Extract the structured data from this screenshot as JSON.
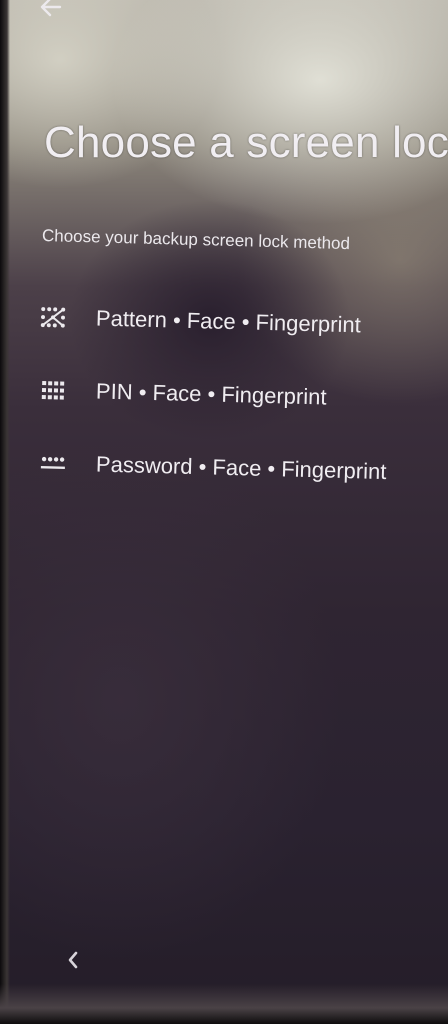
{
  "header": {
    "back_icon": "arrow-left-icon"
  },
  "page": {
    "title": "Choose a screen loc",
    "subtitle": "Choose your backup screen lock method"
  },
  "options": [
    {
      "icon": "pattern-icon",
      "label": "Pattern • Face • Fingerprint"
    },
    {
      "icon": "pin-keypad-icon",
      "label": "PIN • Face • Fingerprint"
    },
    {
      "icon": "password-icon",
      "label": "Password • Face • Fingerprint"
    }
  ],
  "nav": {
    "back_icon": "chevron-left-icon"
  },
  "colors": {
    "text": "#f0edf1"
  }
}
